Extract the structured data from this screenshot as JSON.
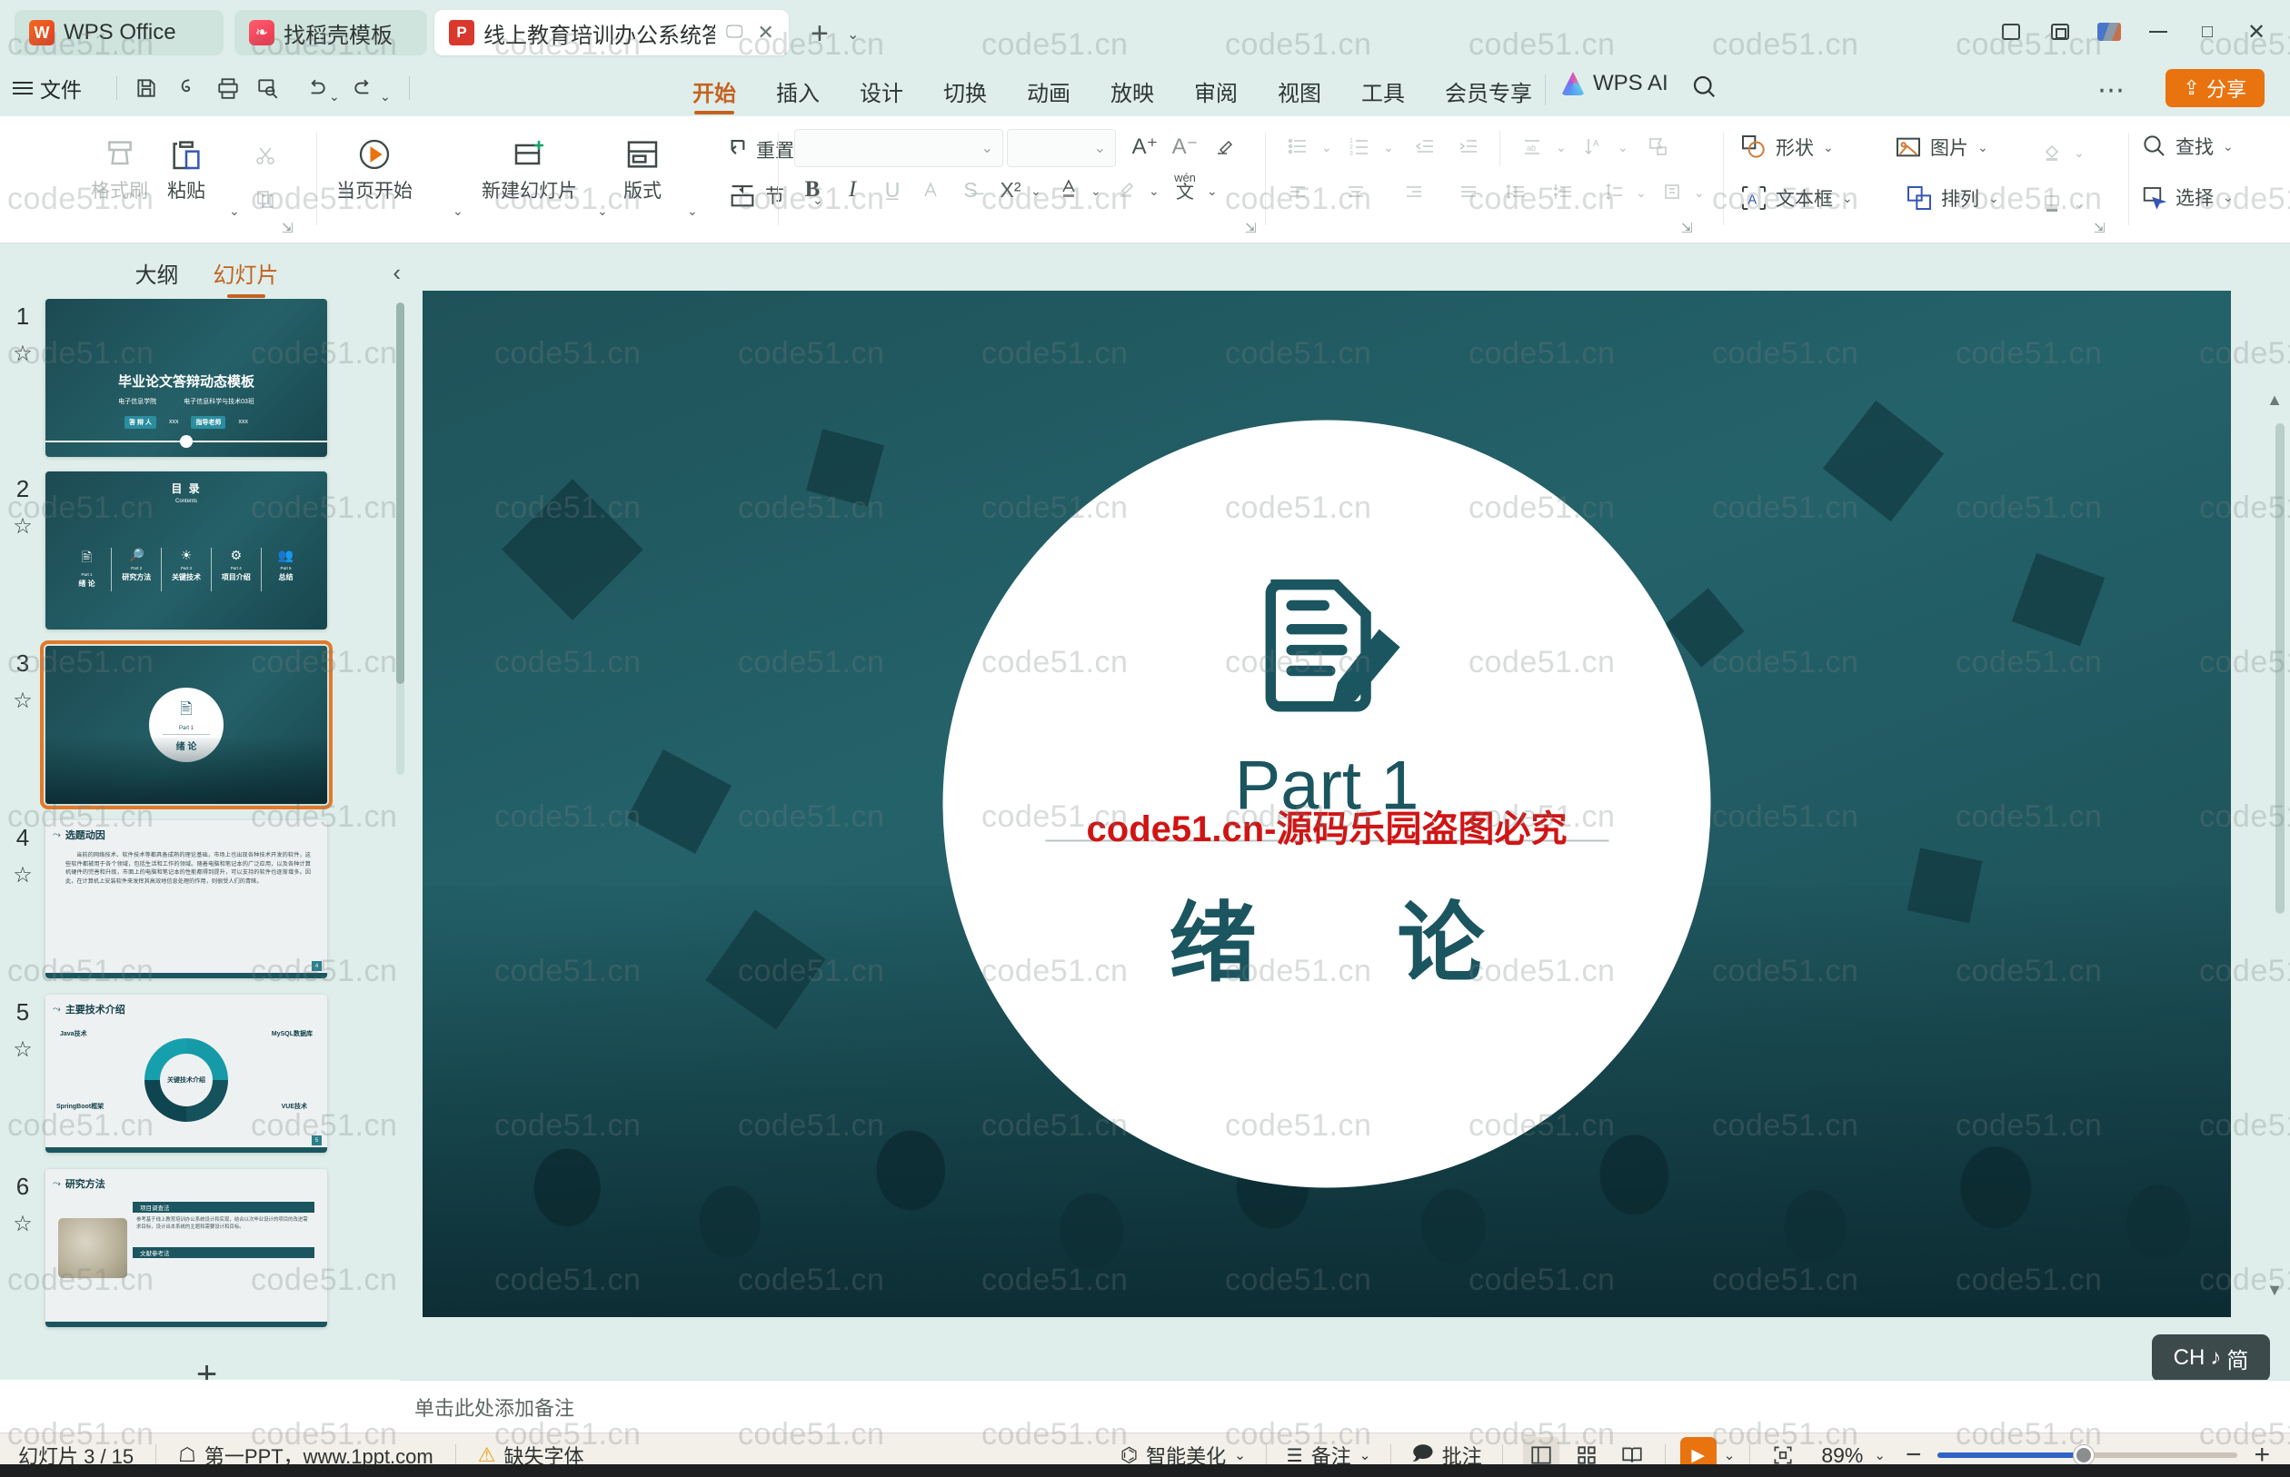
{
  "window": {
    "tabs": [
      {
        "label": "WPS Office",
        "icon": "wps-logo-icon"
      },
      {
        "label": "找稻壳模板",
        "icon": "docer-icon"
      },
      {
        "label": "线上教育培训办公系统答辩PPT",
        "icon": "powerpoint-icon"
      }
    ],
    "new_tab": "+",
    "controls": {
      "minimize": "—",
      "maximize": "□",
      "close": "✕"
    }
  },
  "quick_access": {
    "menu_label": "文件",
    "icons": [
      "save-icon",
      "save-as-icon",
      "print-icon",
      "print-preview-icon",
      "undo-icon",
      "redo-icon"
    ]
  },
  "ribbon_tabs": [
    {
      "label": "开始",
      "active": true
    },
    {
      "label": "插入",
      "active": false
    },
    {
      "label": "设计",
      "active": false
    },
    {
      "label": "切换",
      "active": false
    },
    {
      "label": "动画",
      "active": false
    },
    {
      "label": "放映",
      "active": false
    },
    {
      "label": "审阅",
      "active": false
    },
    {
      "label": "视图",
      "active": false
    },
    {
      "label": "工具",
      "active": false
    },
    {
      "label": "会员专享",
      "active": false
    }
  ],
  "ai_button": "WPS AI",
  "share_button": "分享",
  "ribbon": {
    "clipboard": [
      {
        "label": "格式刷",
        "icon": "format-painter-icon",
        "disabled": true
      },
      {
        "label": "粘贴",
        "icon": "paste-icon",
        "caret": true
      },
      {
        "label": "剪切",
        "icon": "cut-icon",
        "disabled": true
      },
      {
        "label": "复制",
        "icon": "copy-icon",
        "disabled": true
      }
    ],
    "slides": [
      {
        "label": "当页开始",
        "icon": "play-from-current-icon",
        "caret": true
      },
      {
        "label": "新建幻灯片",
        "icon": "new-slide-icon",
        "caret": true
      },
      {
        "label": "版式",
        "icon": "layout-icon",
        "caret": true
      },
      {
        "label": "重置",
        "icon": "reset-icon"
      },
      {
        "label": "节",
        "icon": "section-icon",
        "caret": true
      }
    ],
    "font": {
      "font_name": "",
      "font_size": "",
      "buttons": [
        "A+",
        "A−",
        "clear-format-icon",
        "B",
        "I",
        "U",
        "A-strike",
        "S",
        "X²",
        "font-color-icon",
        "highlight-icon",
        "pinyin-icon"
      ]
    },
    "paragraph": {
      "buttons": [
        "bullets-icon",
        "numbering-icon",
        "decrease-indent-icon",
        "increase-indent-icon",
        "text-direction-icon",
        "sort-icon",
        "smartart-icon",
        "align-left-icon",
        "align-center-icon",
        "align-right-icon",
        "justify-icon",
        "line-spacing-icon",
        "paragraph-spacing-icon",
        "align-vertical-icon",
        "convert-to-smartart-icon"
      ]
    },
    "drawing": [
      {
        "label": "形状",
        "icon": "shapes-icon",
        "caret": true
      },
      {
        "label": "图片",
        "icon": "picture-icon",
        "caret": true
      },
      {
        "label": "文本框",
        "icon": "textbox-icon",
        "caret": true
      },
      {
        "label": "排列",
        "icon": "arrange-icon",
        "caret": true
      },
      {
        "label": "填充",
        "icon": "fill-icon",
        "caret": true,
        "disabled": true
      },
      {
        "label": "轮廓",
        "icon": "outline-icon",
        "caret": true,
        "disabled": true
      }
    ],
    "editing": [
      {
        "label": "查找",
        "icon": "find-icon",
        "caret": true
      },
      {
        "label": "选择",
        "icon": "select-icon",
        "caret": true
      }
    ]
  },
  "left_panel": {
    "tabs": [
      {
        "label": "大纲",
        "active": false
      },
      {
        "label": "幻灯片",
        "active": true
      }
    ],
    "collapse_icon": "chevron-left-icon",
    "add_slide": "+",
    "thumbnails": [
      {
        "number": "1",
        "selected": false,
        "kind": "cover",
        "title": "毕业论文答辩动态模板",
        "sub_left": "电子信息学院",
        "sub_right": "电子信息科学与技术03班",
        "tag1": "答 辩 人",
        "tag1_val": "xxx",
        "tag2": "指导老师",
        "tag2_val": "xxx"
      },
      {
        "number": "2",
        "selected": false,
        "kind": "contents",
        "title": "目  录",
        "subtitle": "Contents",
        "items": [
          {
            "part": "Part 1",
            "label": "绪   论"
          },
          {
            "part": "Part 2",
            "label": "研究方法"
          },
          {
            "part": "Part 3",
            "label": "关键技术"
          },
          {
            "part": "Part 4",
            "label": "项目介绍"
          },
          {
            "part": "Part 5",
            "label": "总结"
          }
        ]
      },
      {
        "number": "3",
        "selected": true,
        "kind": "section",
        "part": "Part 1",
        "label": "绪   论"
      },
      {
        "number": "4",
        "selected": false,
        "kind": "text",
        "title": "选题动因",
        "body": "当前的网络技术、软件技术等都具备成熟的理论基础，市场上也出现各种技术开发的软件，这些软件都被用于各个领域，包括生活和工作的领域。随着电脑和笔记本的广泛应用，以及各种计算机硬件的完善和升级，市面上的电脑和笔记本的性能都得到提升，可以支持的软件也逐渐增多。因此，在计算机上安装软件来发挥其高效地信息处理的作用，则很受人们的青睐。"
      },
      {
        "number": "5",
        "selected": false,
        "kind": "tech",
        "title": "主要技术介绍",
        "center": "关键技术介绍",
        "items": [
          "Java技术",
          "MySQL数据库",
          "SpringBoot框架",
          "VUE技术"
        ]
      },
      {
        "number": "6",
        "selected": false,
        "kind": "method",
        "title": "研究方法",
        "items": [
          "项目调查法",
          "文献参考法"
        ]
      }
    ]
  },
  "slide": {
    "part_label": "Part 1",
    "chapter_title": "绪  论",
    "watermark_red": "code51.cn-源码乐园盗图必究",
    "icon": "document-pen-icon"
  },
  "notes_placeholder": "单击此处添加备注",
  "ime_indicator": {
    "lang": "CH",
    "mode": "简",
    "music_icon": "♪"
  },
  "status_bar": {
    "slide_count": "幻灯片 3 / 15",
    "source_label": "第一PPT，www.1ppt.com",
    "source_icon": "template-icon",
    "font_warning": "缺失字体",
    "warning_icon": "warning-icon",
    "beautify": "智能美化",
    "notes": "备注",
    "comments": "批注",
    "view_icons": [
      "normal-view-icon",
      "slide-sorter-icon",
      "reading-view-icon",
      "slideshow-icon",
      "fit-to-window-icon"
    ],
    "zoom_level": "89%",
    "zoom_minus": "−",
    "zoom_plus": "+"
  },
  "page_watermark": "code51.cn",
  "colors": {
    "accent_orange": "#c4621f",
    "share_orange": "#e8730f",
    "app_bg": "#dfeeea",
    "slide_teal": "#1f5259",
    "chapter_teal": "#1b5560",
    "status_bg": "#f3efe9",
    "red_watermark": "#d01414"
  }
}
